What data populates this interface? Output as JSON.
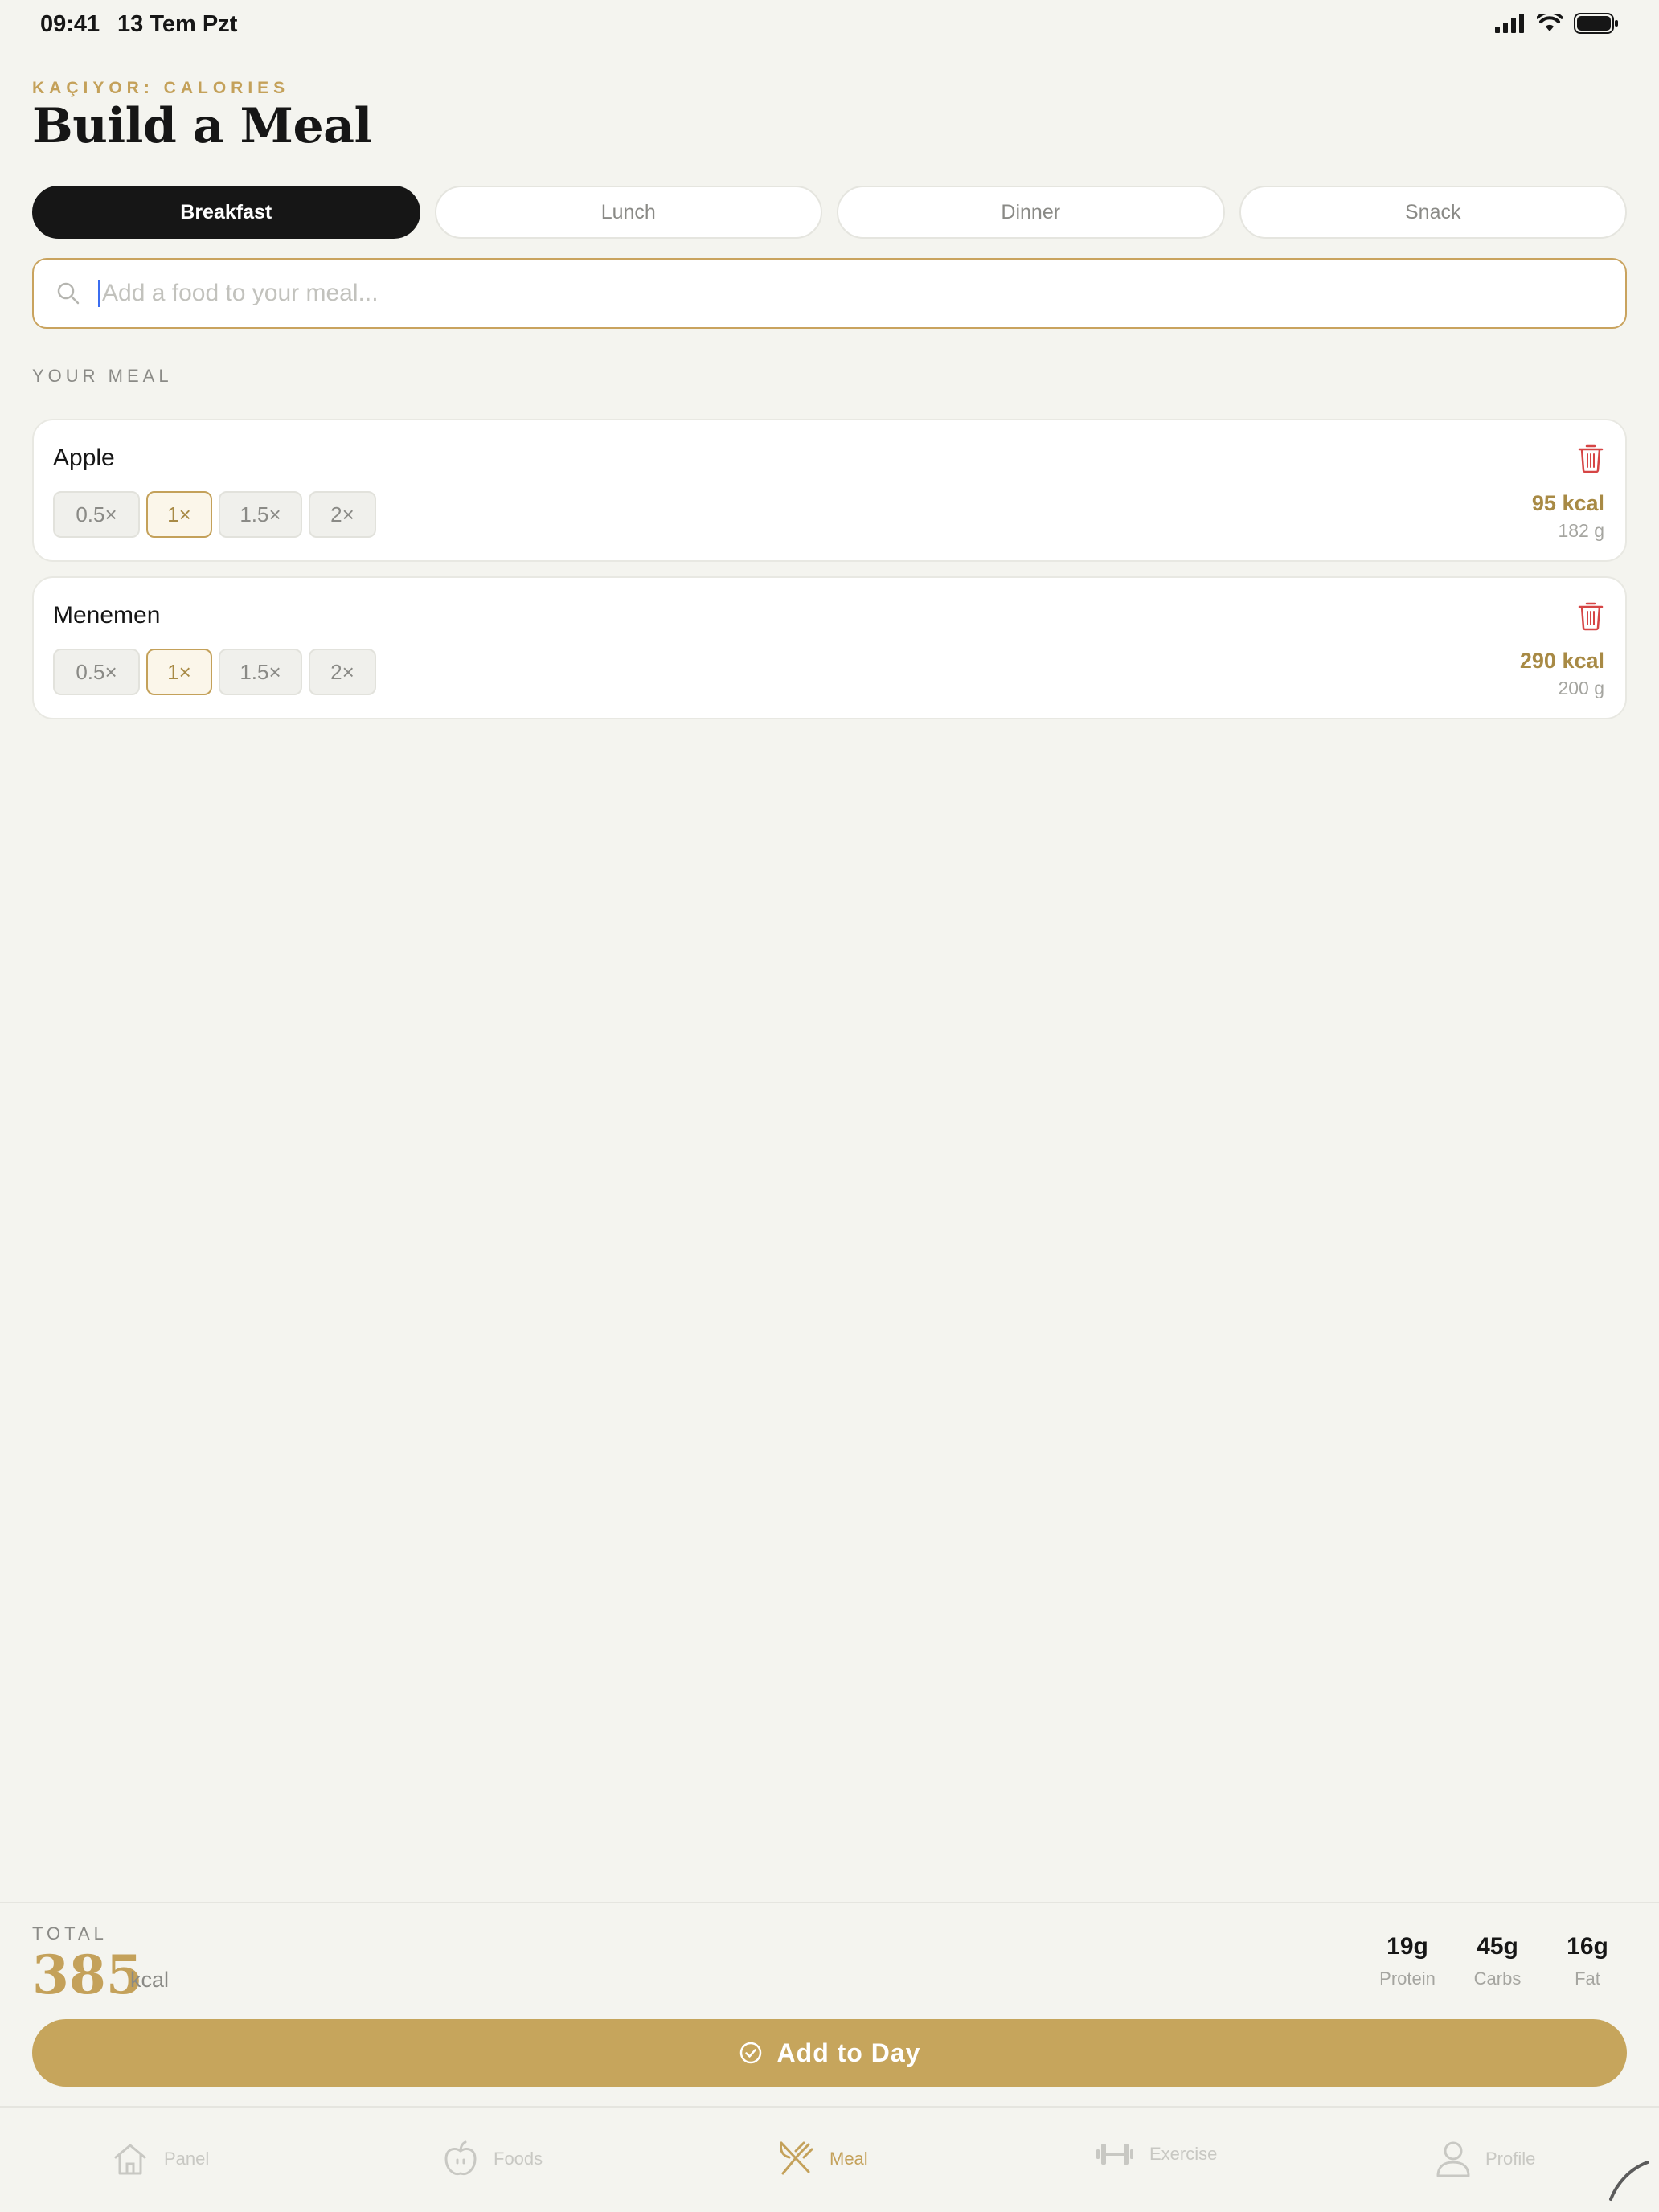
{
  "status_bar": {
    "time": "09:41",
    "date": "13 Tem Pzt"
  },
  "header": {
    "app_label": "KAÇIYOR: CALORIES",
    "title": "Build a Meal"
  },
  "meal_tabs": [
    {
      "label": "Breakfast",
      "active": true
    },
    {
      "label": "Lunch",
      "active": false
    },
    {
      "label": "Dinner",
      "active": false
    },
    {
      "label": "Snack",
      "active": false
    }
  ],
  "search": {
    "placeholder": "Add a food to your meal...",
    "value": ""
  },
  "section_label": "YOUR MEAL",
  "meal_items": [
    {
      "name": "Apple",
      "portions": [
        "0.5×",
        "1×",
        "1.5×",
        "2×"
      ],
      "selected_portion": "1×",
      "kcal": "95 kcal",
      "grams": "182 g"
    },
    {
      "name": "Menemen",
      "portions": [
        "0.5×",
        "1×",
        "1.5×",
        "2×"
      ],
      "selected_portion": "1×",
      "kcal": "290 kcal",
      "grams": "200 g"
    }
  ],
  "total": {
    "label": "TOTAL",
    "value": "385",
    "unit": "kcal",
    "macros": [
      {
        "value": "19g",
        "label": "Protein"
      },
      {
        "value": "45g",
        "label": "Carbs"
      },
      {
        "value": "16g",
        "label": "Fat"
      }
    ]
  },
  "cta": {
    "label": "Add to Day"
  },
  "nav": [
    {
      "label": "Panel",
      "icon": "home-icon",
      "active": false
    },
    {
      "label": "Foods",
      "icon": "apple-icon",
      "active": false
    },
    {
      "label": "Meal",
      "icon": "utensils-icon",
      "active": true
    },
    {
      "label": "Exercise",
      "icon": "dumbbell-icon",
      "active": false
    },
    {
      "label": "Profile",
      "icon": "user-icon",
      "active": false
    }
  ],
  "colors": {
    "accent": "#c4a15a",
    "cta": "#c6a55c",
    "background": "#f4f4ef",
    "danger": "#d64545",
    "active_tab": "#161616"
  }
}
